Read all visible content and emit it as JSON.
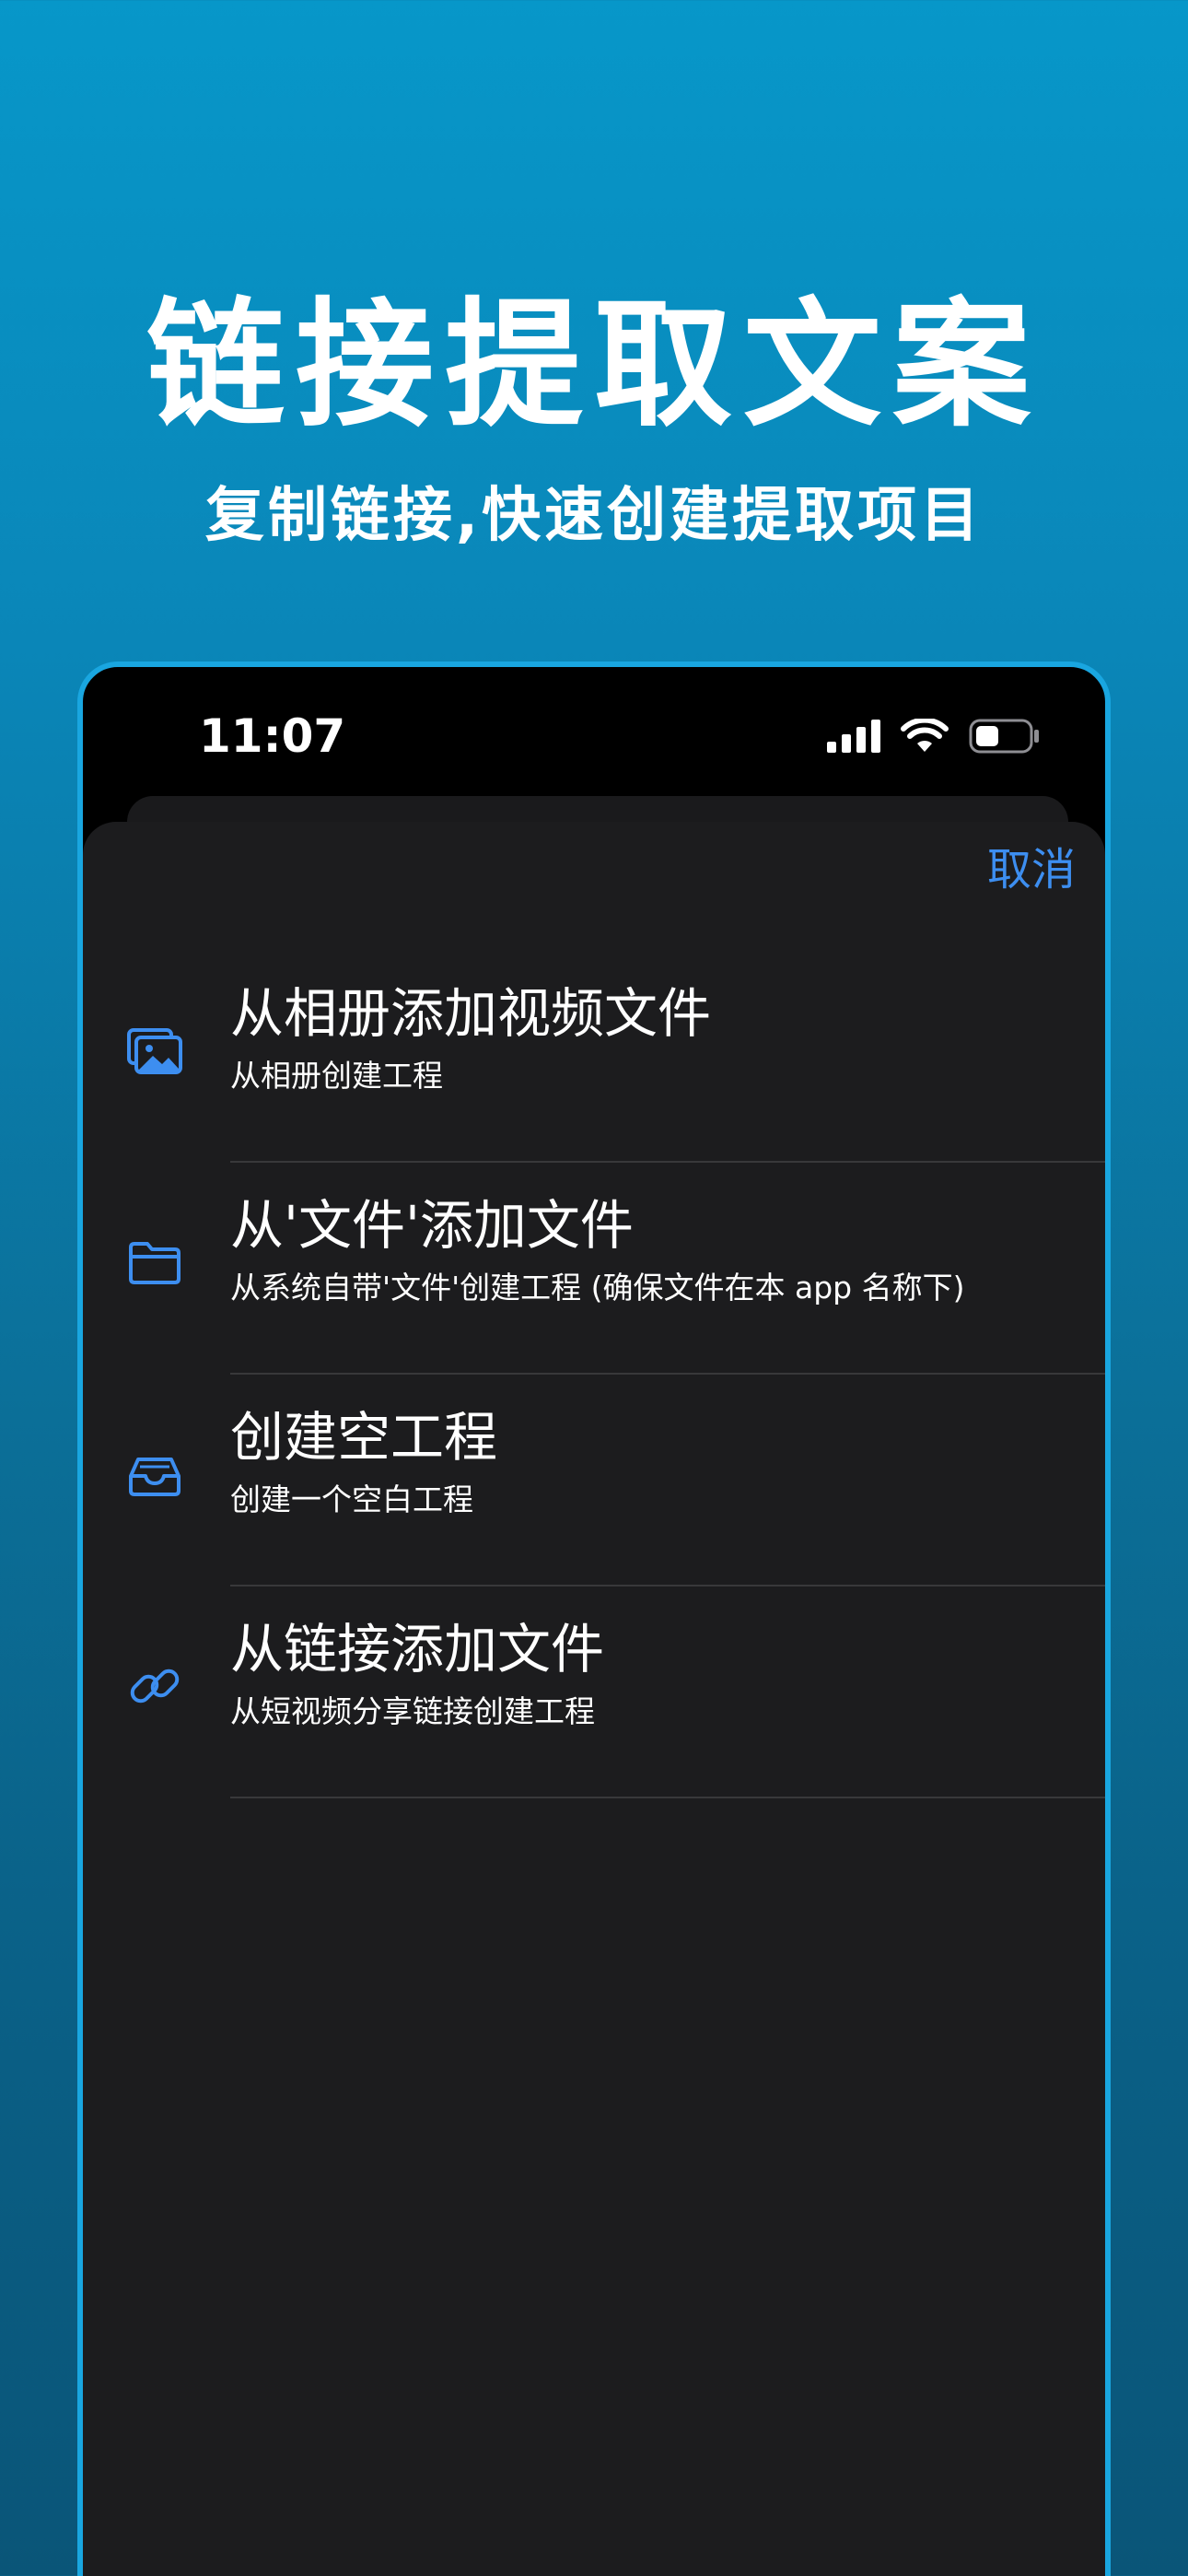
{
  "promo": {
    "headline": "链接提取文案",
    "subheadline": "复制链接,快速创建提取项目"
  },
  "status_bar": {
    "time": "11:07"
  },
  "sheet": {
    "cancel_label": "取消",
    "items": [
      {
        "icon": "photo-album-icon",
        "title": "从相册添加视频文件",
        "subtitle": "从相册创建工程"
      },
      {
        "icon": "folder-icon",
        "title": "从'文件'添加文件",
        "subtitle": "从系统自带'文件'创建工程 (确保文件在本 app 名称下)"
      },
      {
        "icon": "tray-icon",
        "title": "创建空工程",
        "subtitle": "创建一个空白工程"
      },
      {
        "icon": "link-icon",
        "title": "从链接添加文件",
        "subtitle": "从短视频分享链接创建工程"
      }
    ]
  },
  "colors": {
    "accent": "#3d8ef0",
    "sheet_background": "#1c1c1e",
    "frame_border": "#19a6e0"
  }
}
